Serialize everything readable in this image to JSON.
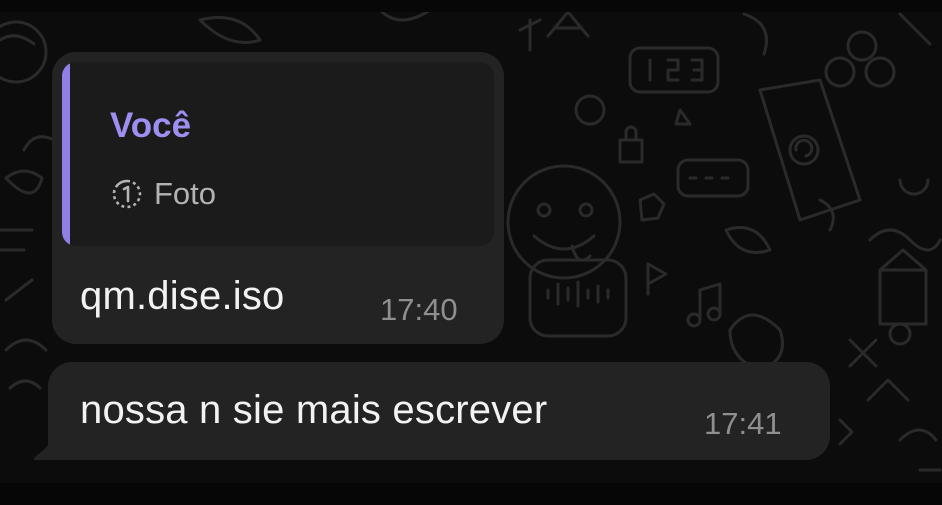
{
  "chat": {
    "messages": [
      {
        "quoted": {
          "author": "Você",
          "media_icon": "view-once-icon",
          "media_label": "Foto"
        },
        "text": "qm.dise.iso",
        "time": "17:40"
      },
      {
        "text": "nossa n sie mais escrever",
        "time": "17:41"
      }
    ]
  },
  "colors": {
    "background": "#0c0c0c",
    "bubble": "#232323",
    "quote_background": "#1b1b1b",
    "quote_accent": "#8f80e8",
    "author_name": "#9d8ff1",
    "timestamp": "#8f8f8f"
  }
}
